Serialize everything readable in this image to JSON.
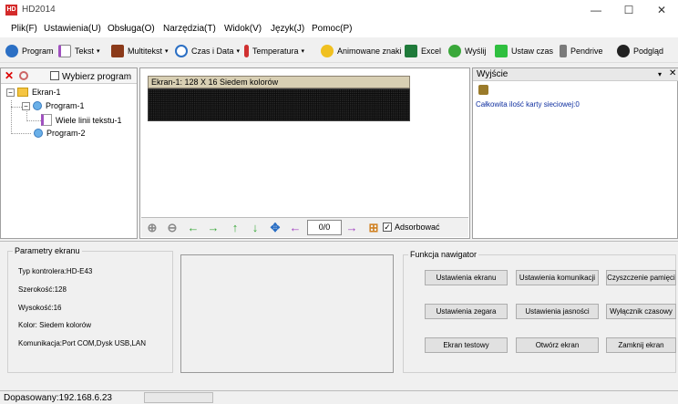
{
  "app": {
    "title": "HD2014",
    "icon_text": "HD"
  },
  "window_controls": {
    "minimize": "—",
    "maximize": "☐",
    "close": "✕"
  },
  "menu": [
    "Plik(F)",
    "Ustawienia(U)",
    "Obsługa(O)",
    "Narzędzia(T)",
    "Widok(V)",
    "Język(J)",
    "Pomoc(P)"
  ],
  "toolbar": {
    "program": "Program",
    "tekst": "Tekst",
    "multitekst": "Multitekst",
    "czas_data": "Czas i Data",
    "temperatura": "Temperatura",
    "animowane": "Animowane znaki",
    "excel": "Excel",
    "wyslij": "Wyślij",
    "ustaw_czas": "Ustaw czas",
    "pendrive": "Pendrive",
    "podglad": "Podgląd",
    "dropdown_glyph": "▾"
  },
  "left_panel": {
    "select_label": "Wybierz program",
    "tree": {
      "screen": "Ekran-1",
      "program1": "Program-1",
      "text_item": "Wiele linii tekstu-1",
      "program2": "Program-2",
      "expanded_glyph": "−"
    }
  },
  "center_panel": {
    "screen_title": "Ekran-1: 128 X 16 Siedem kolorów",
    "page": "0/0",
    "adsorb_label": "Adsorbować",
    "adsorb_checked": true
  },
  "right_panel": {
    "title": "Wyjście",
    "pin_glyph": "▾",
    "close_glyph": "✕",
    "output_text": "Całkowita ilość karty sieciowej:0"
  },
  "params": {
    "title": "Parametry ekranu",
    "controller": "Typ kontrolera:HD-E43",
    "width": "Szerokość:128",
    "height": "Wysokość:16",
    "color": "Kolor: Siedem kolorów",
    "communication": "Komunikacja:Port COM,Dysk USB,LAN"
  },
  "functions": {
    "title": "Funkcja nawigator",
    "buttons": [
      "Ustawienia ekranu",
      "Ustawienia komunikacji",
      "Czyszczenie pamięci",
      "Ustawienia zegara",
      "Ustawienia jasności",
      "Wyłącznik czasowy",
      "Ekran testowy",
      "Otwórz ekran",
      "Zamknij ekran"
    ]
  },
  "status": {
    "text": "Dopasowany:192.168.6.23"
  },
  "colors": {
    "app_red": "#d42b2b",
    "led_bg": "#0c0c0c",
    "screen_title_bg": "#d8cfb3",
    "output_text": "#1030a0",
    "arrow_green": "#3aa83a",
    "arrow_purple": "#a040c0"
  }
}
